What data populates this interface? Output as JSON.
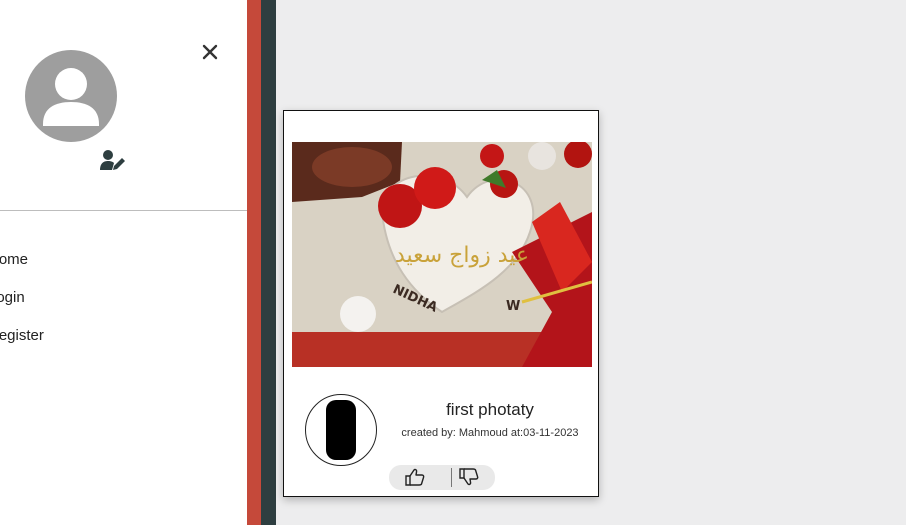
{
  "sidebar": {
    "nav": [
      {
        "label": "Home"
      },
      {
        "label": "Login"
      },
      {
        "label": "Register"
      }
    ]
  },
  "card": {
    "title": "first photaty",
    "meta": "created by: Mahmoud at:03-11-2023",
    "photo_text": {
      "arabic": "عيد زواج سعيد",
      "name_left": "NIDHA",
      "name_right": "W"
    }
  },
  "icons": {
    "close": "close-icon",
    "avatar": "user-avatar-icon",
    "edit_user": "user-edit-icon",
    "like": "thumbs-up-icon",
    "dislike": "thumbs-down-icon"
  },
  "colors": {
    "background": "#ededee",
    "stripe_red": "#c5493a",
    "stripe_dark": "#2e3e40",
    "avatar_gray": "#9e9e9e"
  }
}
